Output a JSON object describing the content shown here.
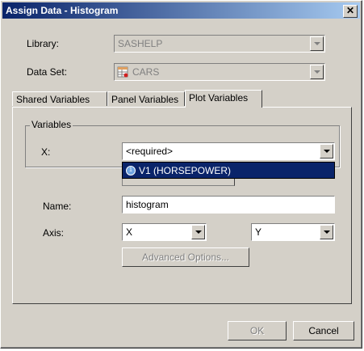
{
  "window": {
    "title": "Assign Data - Histogram",
    "close_symbol": "✕"
  },
  "fields": {
    "library": {
      "label": "Library:",
      "value": "SASHELP"
    },
    "dataset": {
      "label": "Data Set:",
      "value": "CARS"
    }
  },
  "tabs": [
    {
      "label": "Shared Variables"
    },
    {
      "label": "Panel Variables"
    },
    {
      "label": "Plot Variables",
      "active": true
    }
  ],
  "variables_group": {
    "title": "Variables",
    "x_label": "X:",
    "x_value": "<required>",
    "dropdown_option": "V1  (HORSEPOWER)"
  },
  "name": {
    "label": "Name:",
    "value": "histogram"
  },
  "axis": {
    "label": "Axis:",
    "x_value": "X",
    "y_value": "Y"
  },
  "buttons": {
    "advanced": "Advanced Options...",
    "ok": "OK",
    "cancel": "Cancel"
  },
  "colors": {
    "title_start": "#0a246a",
    "title_end": "#a6caf0",
    "highlight": "#0a246a",
    "face": "#d4d0c8"
  }
}
